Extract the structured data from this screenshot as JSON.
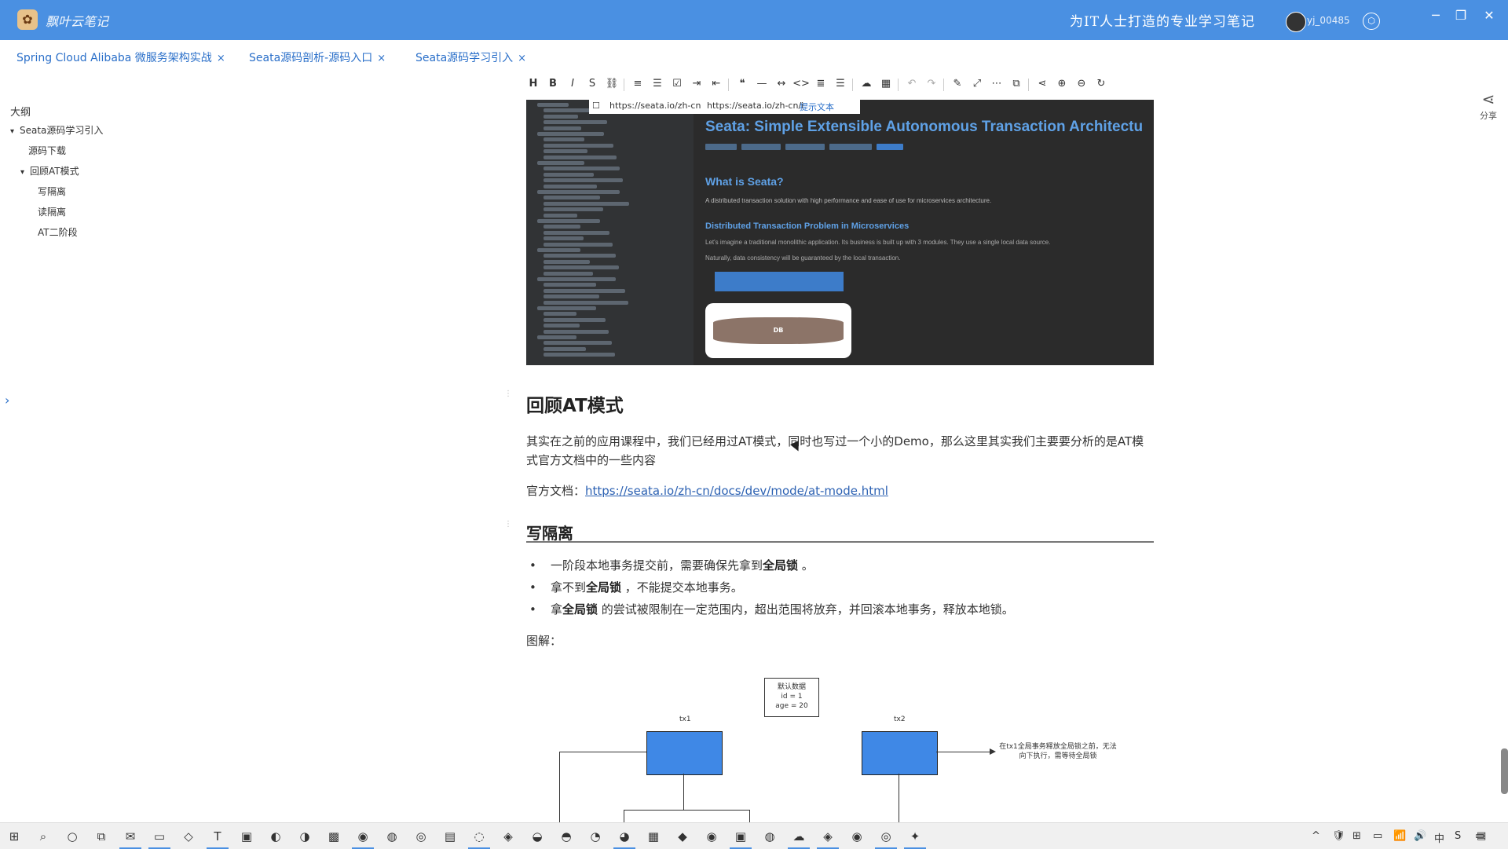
{
  "titlebar": {
    "app_name": "飘叶云笔记",
    "slogan": "为IT人士打造的专业学习笔记",
    "user": "yj_00485",
    "colors": {
      "bar": "#4a90e2"
    }
  },
  "tabs": [
    {
      "label": "Spring Cloud Alibaba 微服务架构实战",
      "close": "×"
    },
    {
      "label": "Seata源码剖析-源码入口",
      "close": "×"
    },
    {
      "label": "Seata源码学习引入",
      "close": "×"
    }
  ],
  "outline": {
    "title": "大纲",
    "items": [
      {
        "label": "Seata源码学习引入",
        "caret": "▾"
      },
      {
        "label": "源码下载",
        "caret": ""
      },
      {
        "label": "回顾AT模式",
        "caret": "▾"
      },
      {
        "label": "写隔离",
        "caret": ""
      },
      {
        "label": "读隔离",
        "caret": ""
      },
      {
        "label": "AT二阶段",
        "caret": ""
      }
    ],
    "expand_arrow": "›"
  },
  "toolbar": {
    "icons": [
      "heading-icon",
      "bold-icon",
      "italic-icon",
      "strikethrough-icon",
      "link-icon",
      "bullet-list-icon",
      "ordered-list-icon",
      "checklist-icon",
      "indent-icon",
      "outdent-icon",
      "quote-icon",
      "horizontal-rule-icon",
      "inline-code-icon",
      "code-block-icon",
      "align-icon",
      "align-right-icon",
      "upload-icon",
      "table-icon",
      "undo-icon",
      "redo-icon",
      "edit-icon",
      "open-external-icon",
      "more-icon",
      "copy-icon",
      "share-icon",
      "zoom-in-icon",
      "zoom-out-icon",
      "refresh-icon"
    ],
    "glyphs": [
      "H",
      "B",
      "I",
      "S",
      "⛓",
      "≡",
      "☰",
      "☑",
      "⇥",
      "⇤",
      "❝",
      "—",
      "↔",
      "<>",
      "≣",
      "☰",
      "☁",
      "▦",
      "↶",
      "↷",
      "✎",
      "⤢",
      "⋯",
      "⧉",
      "⋖",
      "⊕",
      "⊖",
      "↻"
    ]
  },
  "share": {
    "icon": "share-icon",
    "label": "分享"
  },
  "embedded_screenshot": {
    "url_left": "https://seata.io/zh-cn",
    "url_mid": "https://seata.io/zh-cn/i",
    "url_hint": "提示文本",
    "title": "Seata: Simple Extensible Autonomous Transaction Architectu",
    "what_heading": "What is Seata?",
    "what_text": "A distributed transaction solution with high performance and ease of use for microservices architecture.",
    "dist_heading": "Distributed Transaction Problem in Microservices",
    "dist_text": "Let's imagine a traditional monolithic application. Its business is built up with 3 modules. They use a single local data source.",
    "dist_text2": "Naturally, data consistency will be guaranteed by the local transaction.",
    "db_label": "DB"
  },
  "article": {
    "h_review": "回顾AT模式",
    "p_intro": "其实在之前的应用课程中，我们已经用过AT模式，同时也写过一个小的Demo，那么这里其实我们主要要分析的是AT模式官方文档中的一些内容",
    "doc_prefix": "官方文档：",
    "doc_link": "https://seata.io/zh-cn/docs/dev/mode/at-mode.html",
    "h_write": "写隔离",
    "bullets": [
      {
        "pre": "一阶段本地事务提交前，需要确保先拿到",
        "bold": "全局锁",
        "post": " 。"
      },
      {
        "pre": "拿不到",
        "bold": "全局锁",
        "post": " ，不能提交本地事务。"
      },
      {
        "pre": "拿",
        "bold": "全局锁",
        "post": " 的尝试被限制在一定范围内，超出范围将放弃，并回滚本地事务，释放本地锁。"
      }
    ],
    "diagram_label": "图解：",
    "diagram": {
      "data_line1": "默认数据",
      "data_line2": "id = 1",
      "data_line3": "age = 20",
      "tx1": "tx1",
      "tx2": "tx2",
      "note": "在tx1全局事务释放全局锁之前，无法向下执行，需等待全局锁"
    }
  },
  "taskbar": {
    "icons": [
      "windows-start-icon",
      "search-icon",
      "cortana-icon",
      "task-view-icon",
      "mail-icon",
      "file-explorer-icon",
      "chat-icon",
      "text-editor-icon",
      "app-icon",
      "browser-icon",
      "app2-icon",
      "app3-icon",
      "chrome-icon",
      "app4-icon",
      "steam-icon",
      "app5-icon",
      "app6-icon",
      "app7-icon",
      "app8-icon",
      "app9-icon",
      "app10-icon",
      "app11-icon",
      "app12-icon",
      "app13-icon",
      "app14-icon",
      "app15-icon",
      "app16-icon",
      "app17-icon",
      "app18-icon",
      "app19-icon",
      "app20-icon",
      "app21-icon"
    ],
    "glyphs": [
      "⊞",
      "⌕",
      "○",
      "⧉",
      "✉",
      "▭",
      "◇",
      "T",
      "▣",
      "◐",
      "◑",
      "▩",
      "◉",
      "◍",
      "◎",
      "▤",
      "◌",
      "◈",
      "◒",
      "◓",
      "◔",
      "◕",
      "▦",
      "◆",
      "◉",
      "▣",
      "◍",
      "☁",
      "◈",
      "◉",
      "◎",
      "✦"
    ],
    "tray": [
      "^",
      "🛡",
      "⊞",
      "▭",
      "📶",
      "🔊",
      "中",
      "S",
      "▭"
    ]
  }
}
